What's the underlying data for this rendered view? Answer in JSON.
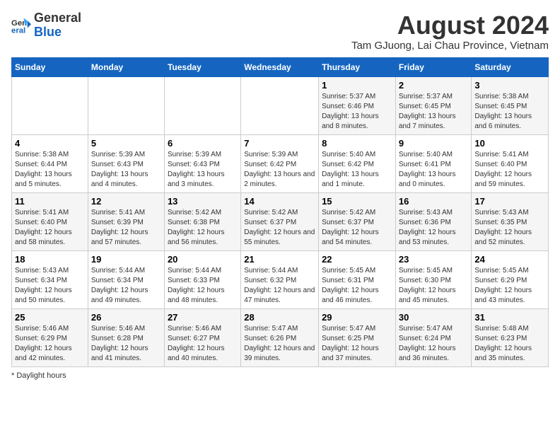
{
  "logo": {
    "general": "General",
    "blue": "Blue"
  },
  "title": "August 2024",
  "location": "Tam GJuong, Lai Chau Province, Vietnam",
  "days_of_week": [
    "Sunday",
    "Monday",
    "Tuesday",
    "Wednesday",
    "Thursday",
    "Friday",
    "Saturday"
  ],
  "footer": "Daylight hours",
  "weeks": [
    [
      {
        "day": "",
        "info": ""
      },
      {
        "day": "",
        "info": ""
      },
      {
        "day": "",
        "info": ""
      },
      {
        "day": "",
        "info": ""
      },
      {
        "day": "1",
        "info": "Sunrise: 5:37 AM\nSunset: 6:46 PM\nDaylight: 13 hours and 8 minutes."
      },
      {
        "day": "2",
        "info": "Sunrise: 5:37 AM\nSunset: 6:45 PM\nDaylight: 13 hours and 7 minutes."
      },
      {
        "day": "3",
        "info": "Sunrise: 5:38 AM\nSunset: 6:45 PM\nDaylight: 13 hours and 6 minutes."
      }
    ],
    [
      {
        "day": "4",
        "info": "Sunrise: 5:38 AM\nSunset: 6:44 PM\nDaylight: 13 hours and 5 minutes."
      },
      {
        "day": "5",
        "info": "Sunrise: 5:39 AM\nSunset: 6:43 PM\nDaylight: 13 hours and 4 minutes."
      },
      {
        "day": "6",
        "info": "Sunrise: 5:39 AM\nSunset: 6:43 PM\nDaylight: 13 hours and 3 minutes."
      },
      {
        "day": "7",
        "info": "Sunrise: 5:39 AM\nSunset: 6:42 PM\nDaylight: 13 hours and 2 minutes."
      },
      {
        "day": "8",
        "info": "Sunrise: 5:40 AM\nSunset: 6:42 PM\nDaylight: 13 hours and 1 minute."
      },
      {
        "day": "9",
        "info": "Sunrise: 5:40 AM\nSunset: 6:41 PM\nDaylight: 13 hours and 0 minutes."
      },
      {
        "day": "10",
        "info": "Sunrise: 5:41 AM\nSunset: 6:40 PM\nDaylight: 12 hours and 59 minutes."
      }
    ],
    [
      {
        "day": "11",
        "info": "Sunrise: 5:41 AM\nSunset: 6:40 PM\nDaylight: 12 hours and 58 minutes."
      },
      {
        "day": "12",
        "info": "Sunrise: 5:41 AM\nSunset: 6:39 PM\nDaylight: 12 hours and 57 minutes."
      },
      {
        "day": "13",
        "info": "Sunrise: 5:42 AM\nSunset: 6:38 PM\nDaylight: 12 hours and 56 minutes."
      },
      {
        "day": "14",
        "info": "Sunrise: 5:42 AM\nSunset: 6:37 PM\nDaylight: 12 hours and 55 minutes."
      },
      {
        "day": "15",
        "info": "Sunrise: 5:42 AM\nSunset: 6:37 PM\nDaylight: 12 hours and 54 minutes."
      },
      {
        "day": "16",
        "info": "Sunrise: 5:43 AM\nSunset: 6:36 PM\nDaylight: 12 hours and 53 minutes."
      },
      {
        "day": "17",
        "info": "Sunrise: 5:43 AM\nSunset: 6:35 PM\nDaylight: 12 hours and 52 minutes."
      }
    ],
    [
      {
        "day": "18",
        "info": "Sunrise: 5:43 AM\nSunset: 6:34 PM\nDaylight: 12 hours and 50 minutes."
      },
      {
        "day": "19",
        "info": "Sunrise: 5:44 AM\nSunset: 6:34 PM\nDaylight: 12 hours and 49 minutes."
      },
      {
        "day": "20",
        "info": "Sunrise: 5:44 AM\nSunset: 6:33 PM\nDaylight: 12 hours and 48 minutes."
      },
      {
        "day": "21",
        "info": "Sunrise: 5:44 AM\nSunset: 6:32 PM\nDaylight: 12 hours and 47 minutes."
      },
      {
        "day": "22",
        "info": "Sunrise: 5:45 AM\nSunset: 6:31 PM\nDaylight: 12 hours and 46 minutes."
      },
      {
        "day": "23",
        "info": "Sunrise: 5:45 AM\nSunset: 6:30 PM\nDaylight: 12 hours and 45 minutes."
      },
      {
        "day": "24",
        "info": "Sunrise: 5:45 AM\nSunset: 6:29 PM\nDaylight: 12 hours and 43 minutes."
      }
    ],
    [
      {
        "day": "25",
        "info": "Sunrise: 5:46 AM\nSunset: 6:29 PM\nDaylight: 12 hours and 42 minutes."
      },
      {
        "day": "26",
        "info": "Sunrise: 5:46 AM\nSunset: 6:28 PM\nDaylight: 12 hours and 41 minutes."
      },
      {
        "day": "27",
        "info": "Sunrise: 5:46 AM\nSunset: 6:27 PM\nDaylight: 12 hours and 40 minutes."
      },
      {
        "day": "28",
        "info": "Sunrise: 5:47 AM\nSunset: 6:26 PM\nDaylight: 12 hours and 39 minutes."
      },
      {
        "day": "29",
        "info": "Sunrise: 5:47 AM\nSunset: 6:25 PM\nDaylight: 12 hours and 37 minutes."
      },
      {
        "day": "30",
        "info": "Sunrise: 5:47 AM\nSunset: 6:24 PM\nDaylight: 12 hours and 36 minutes."
      },
      {
        "day": "31",
        "info": "Sunrise: 5:48 AM\nSunset: 6:23 PM\nDaylight: 12 hours and 35 minutes."
      }
    ]
  ]
}
